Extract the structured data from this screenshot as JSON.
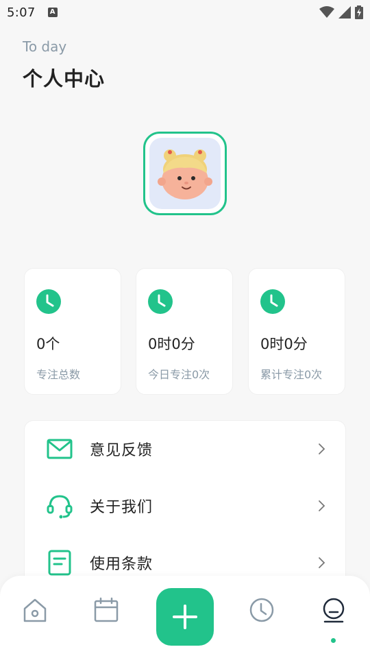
{
  "status_bar": {
    "time": "5:07",
    "notification_icon": "A"
  },
  "header": {
    "subtitle": "To day",
    "title": "个人中心"
  },
  "profile": {
    "avatar_icon": "cartoon-girl-avatar"
  },
  "stats": [
    {
      "value": "0个",
      "label": "专注总数",
      "icon": "clock-icon"
    },
    {
      "value": "0时0分",
      "label": "今日专注0次",
      "icon": "clock-icon"
    },
    {
      "value": "0时0分",
      "label": "累计专注0次",
      "icon": "clock-icon"
    }
  ],
  "menu": {
    "items": [
      {
        "label": "意见反馈",
        "icon": "mail-icon"
      },
      {
        "label": "关于我们",
        "icon": "headset-icon"
      },
      {
        "label": "使用条款",
        "icon": "document-icon"
      }
    ]
  },
  "bottom_nav": {
    "items": [
      "home-icon",
      "calendar-icon",
      "add-icon",
      "clock-icon",
      "profile-icon"
    ],
    "active": "profile-icon"
  },
  "colors": {
    "accent": "#22c38b",
    "muted_text": "#8a9aa7",
    "background": "#f7f7f7"
  }
}
